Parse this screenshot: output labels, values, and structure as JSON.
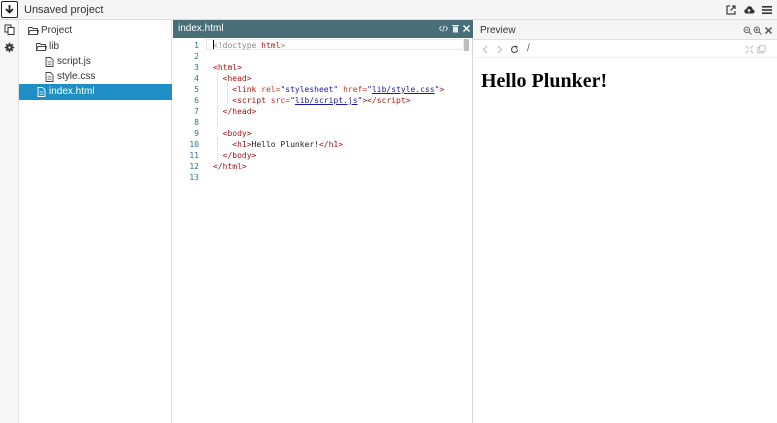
{
  "topbar": {
    "project_title": "Unsaved project",
    "icons": [
      "download-logo-icon",
      "external-link-icon",
      "cloud-upload-icon",
      "menu-icon"
    ]
  },
  "rail": {
    "icons": [
      "files-icon",
      "gear-icon"
    ]
  },
  "tree": {
    "items": [
      {
        "label": "Project",
        "type": "folder",
        "depth": 0,
        "active": false
      },
      {
        "label": "lib",
        "type": "folder",
        "depth": 1,
        "active": false
      },
      {
        "label": "script.js",
        "type": "file",
        "depth": 2,
        "active": false
      },
      {
        "label": "style.css",
        "type": "file",
        "depth": 2,
        "active": false
      },
      {
        "label": "index.html",
        "type": "file",
        "depth": 1,
        "active": true
      }
    ]
  },
  "editor": {
    "tab_name": "index.html",
    "line_numbers": [
      "1",
      "2",
      "3",
      "4",
      "5",
      "6",
      "7",
      "8",
      "9",
      "10",
      "11",
      "12",
      "13"
    ]
  },
  "preview": {
    "title": "Preview",
    "path": "/",
    "heading": "Hello Plunker!"
  },
  "colors": {
    "active_item": "#1e8fc4",
    "editor_tab": "#486e78"
  }
}
